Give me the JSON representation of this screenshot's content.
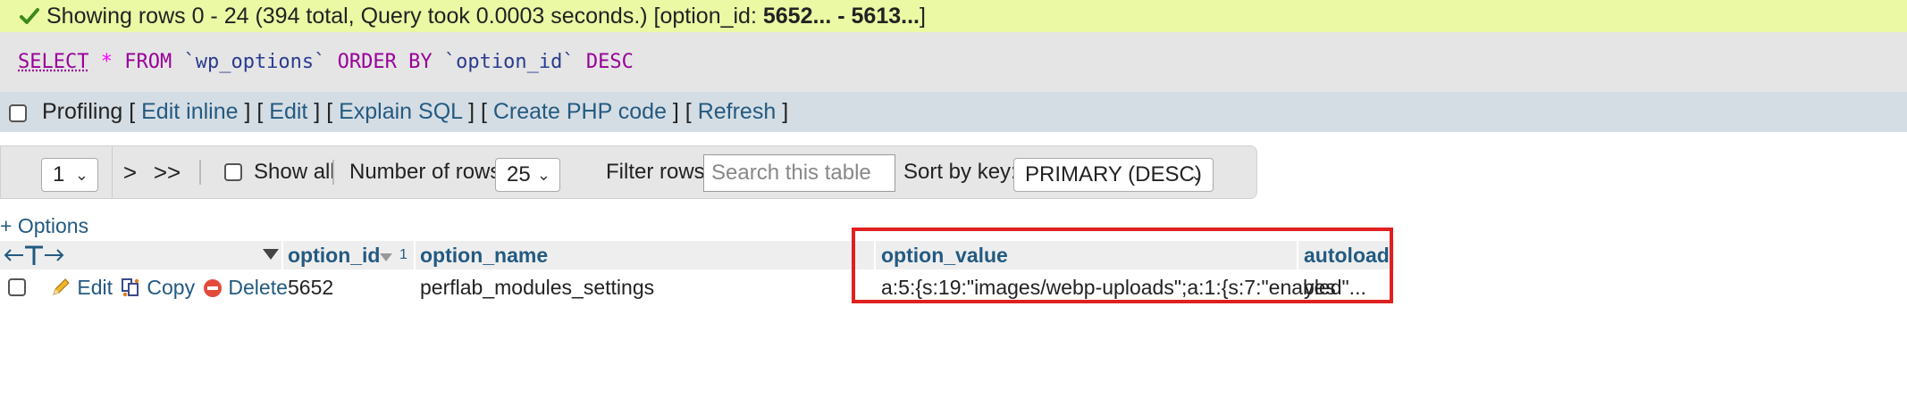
{
  "success": {
    "message": "Showing rows 0 - 24 (394 total, Query took 0.0003 seconds.) [option_id: ",
    "range": "5652... - 5613...",
    "close": "]",
    "icon": "check-icon",
    "color": "#ebf8a4"
  },
  "sql": {
    "select": "SELECT",
    "star": "*",
    "from": "FROM",
    "table": "`wp_options`",
    "order_by": "ORDER BY",
    "column": "`option_id`",
    "dir": "DESC"
  },
  "profiling": {
    "label": "Profiling",
    "links": [
      "Edit inline",
      "Edit",
      "Explain SQL",
      "Create PHP code",
      "Refresh"
    ]
  },
  "nav": {
    "page": "1",
    "next": ">",
    "last": ">>",
    "show_all": "Show all",
    "num_rows_label": "Number of rows:",
    "num_rows_value": "25",
    "filter_label": "Filter rows:",
    "filter_placeholder": "Search this table",
    "sort_label": "Sort by key:",
    "sort_value": "PRIMARY (DESC)"
  },
  "options_link": "+ Options",
  "table": {
    "headers": {
      "option_id": "option_id",
      "sort_index": "1",
      "option_name": "option_name",
      "option_value": "option_value",
      "autoload": "autoload"
    },
    "rows": [
      {
        "edit": "Edit",
        "copy": "Copy",
        "delete": "Delete",
        "option_id": "5652",
        "option_name": "perflab_modules_settings",
        "option_value": "a:5:{s:19:\"images/webp-uploads\";a:1:{s:7:\"enabled\"...",
        "autoload": "yes"
      }
    ]
  },
  "highlight_color": "#e02020"
}
